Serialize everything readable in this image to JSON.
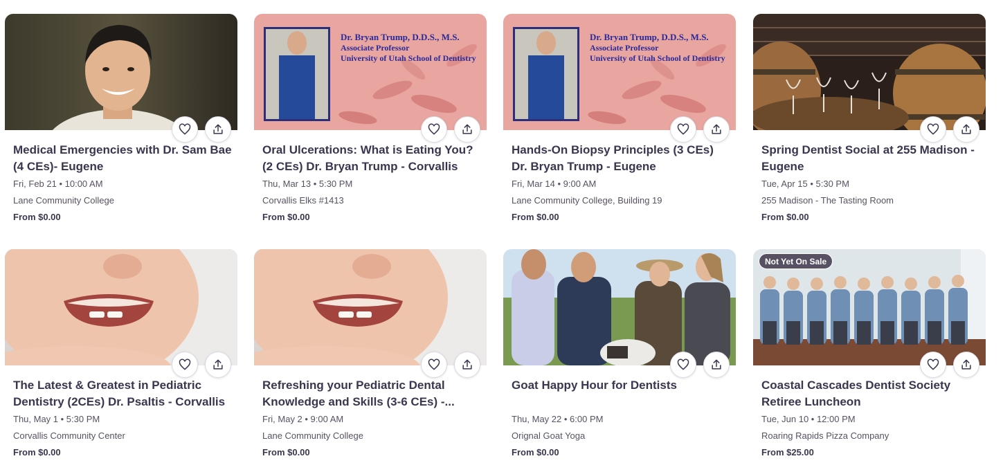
{
  "events": [
    {
      "title": "Medical Emergencies with Dr. Sam Bae (4 CEs)- Eugene",
      "date": "Fri, Feb 21 • 10:00 AM",
      "venue": "Lane Community College",
      "price": "From $0.00"
    },
    {
      "title": "Oral Ulcerations: What is Eating You? (2 CEs) Dr. Bryan Trump - Corvallis",
      "date": "Thu, Mar 13 • 5:30 PM",
      "venue": "Corvallis Elks #1413",
      "price": "From $0.00",
      "image_text": [
        "Dr. Bryan Trump, D.D.S., M.S.",
        "Associate Professor",
        "University of Utah School of Dentistry"
      ]
    },
    {
      "title": "Hands-On Biopsy Principles (3 CEs) Dr. Bryan Trump - Eugene",
      "date": "Fri, Mar 14 • 9:00 AM",
      "venue": "Lane Community College, Building 19",
      "price": "From $0.00",
      "image_text": [
        "Dr. Bryan Trump, D.D.S., M.S.",
        "Associate Professor",
        "University of Utah School of Dentistry"
      ]
    },
    {
      "title": "Spring Dentist Social at 255 Madison - Eugene",
      "date": "Tue, Apr 15 • 5:30 PM",
      "venue": "255 Madison - The Tasting Room",
      "price": "From $0.00"
    },
    {
      "title": "The Latest & Greatest in Pediatric Dentistry (2CEs) Dr. Psaltis - Corvallis",
      "date": "Thu, May 1 • 5:30 PM",
      "venue": "Corvallis Community Center",
      "price": "From $0.00"
    },
    {
      "title": "Refreshing your Pediatric Dental Knowledge and Skills (3-6 CEs) -...",
      "date": "Fri, May 2 • 9:00 AM",
      "venue": "Lane Community College",
      "price": "From $0.00"
    },
    {
      "title": "Goat Happy Hour for Dentists",
      "date": "Thu, May 22 • 6:00 PM",
      "venue": "Orignal Goat Yoga",
      "price": "From $0.00"
    },
    {
      "title": "Coastal Cascades Dentist Society Retiree Luncheon",
      "date": "Tue, Jun 10 • 12:00 PM",
      "venue": "Roaring Rapids Pizza Company",
      "price": "From $25.00",
      "badge": "Not Yet On Sale"
    }
  ],
  "icons": {
    "like": "heart-icon",
    "share": "share-icon"
  },
  "colors": {
    "text_primary": "#39364f",
    "text_secondary": "#585163",
    "badge_bg": "#585163",
    "button_border": "#dbdae3"
  }
}
